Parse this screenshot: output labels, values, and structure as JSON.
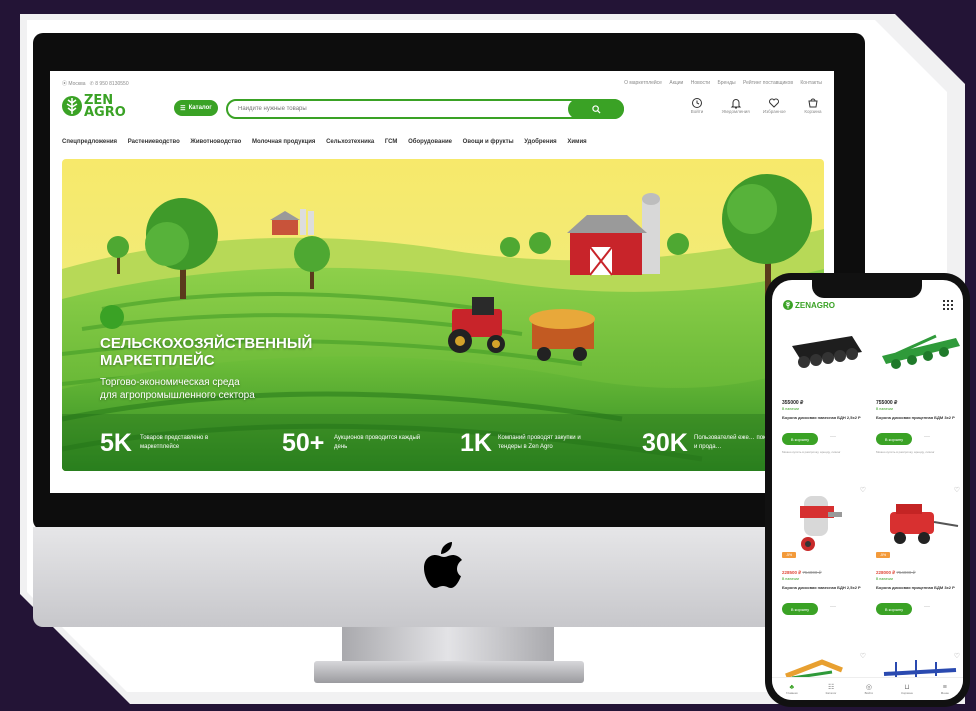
{
  "site": {
    "topbar": {
      "city": "Москва",
      "phone": "8 950 8130550",
      "links": [
        "О маркетплейсе",
        "Акции",
        "Новости",
        "Бренды",
        "Рейтинг поставщиков",
        "Контакты"
      ]
    },
    "logo": {
      "line1": "ZEN",
      "line2": "AGRO"
    },
    "catalog_label": "Каталог",
    "search_placeholder": "Найдите нужные товары",
    "user_icons": [
      {
        "icon": "clock-icon",
        "label": "Войти"
      },
      {
        "icon": "bell-icon",
        "label": "Уведомления"
      },
      {
        "icon": "heart-icon",
        "label": "Избранное"
      },
      {
        "icon": "cart-icon",
        "label": "Корзина"
      }
    ],
    "nav": [
      "Спецпредложения",
      "Растениеводство",
      "Животноводство",
      "Молочная продукция",
      "Сельхозтехника",
      "ГСМ",
      "Оборудование",
      "Овощи и фрукты",
      "Удобрения",
      "Химия"
    ],
    "hero": {
      "title_line1": "СЕЛЬСКОХОЗЯЙСТВЕННЫЙ",
      "title_line2": "МАРКЕТПЛЕЙС",
      "sub_line1": "Торгово-экономическая среда",
      "sub_line2": "для агропромышленного сектора",
      "stats": [
        {
          "num": "5K",
          "text": "Товаров представлено в маркетплейсе"
        },
        {
          "num": "50+",
          "text": "Аукционов проводится каждый день"
        },
        {
          "num": "1K",
          "text": "Компаний проводят закупки и тендеры в Zen Agro"
        },
        {
          "num": "30K",
          "text": "Пользователей еже… покупают и прода…"
        }
      ]
    }
  },
  "phone": {
    "logo": "ZENAGRO",
    "products": [
      {
        "price": "355000 ₽",
        "avail": "В наличии",
        "name": "Борона дисковая навесная БДН 2,5х2 Р",
        "btn": "В корзину",
        "note": "Можно купить в рассрочку, аренду, лизинг",
        "badge": "",
        "old": ""
      },
      {
        "price": "755000 ₽",
        "avail": "В наличии",
        "name": "Борона дисковая прицепная БДМ 3х2 Р",
        "btn": "В корзину",
        "note": "Можно купить в рассрочку, аренду, лизинг",
        "badge": "",
        "old": ""
      },
      {
        "price": "",
        "avail": "В наличии",
        "name": "Борона дисковая навесная БДН 2,5х2 Р",
        "btn": "В корзину",
        "note": "",
        "badge": "-5%",
        "old": "228500 ₽",
        "old2": "754000 ₽"
      },
      {
        "price": "",
        "avail": "В наличии",
        "name": "Борона дисковая прицепная БДМ 3х2 Р",
        "btn": "В корзину",
        "note": "",
        "badge": "-5%",
        "old": "228000 ₽",
        "old2": "754000 ₽"
      }
    ],
    "tabbar": [
      "Главная",
      "Каталог",
      "Войти",
      "Корзина",
      "Меню"
    ]
  },
  "colors": {
    "accent": "#3aa225",
    "frame_bg": "#231436",
    "badge": "#f39a3a"
  }
}
